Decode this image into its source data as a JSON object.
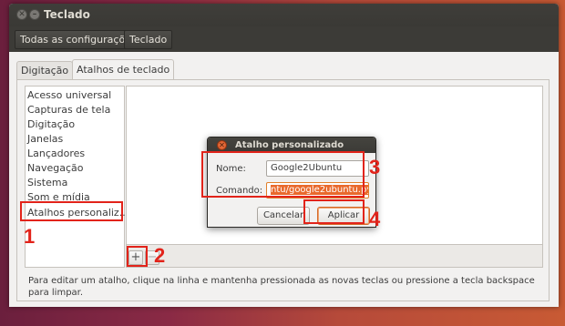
{
  "window": {
    "title": "Teclado",
    "breadcrumbs": [
      "Todas as configurações",
      "Teclado"
    ]
  },
  "tabs": [
    "Digitação",
    "Atalhos de teclado"
  ],
  "categories": [
    "Acesso universal",
    "Capturas de tela",
    "Digitação",
    "Janelas",
    "Lançadores",
    "Navegação",
    "Sistema",
    "Som e mídia",
    "Atalhos personaliz..."
  ],
  "list_buttons": {
    "add": "+",
    "remove": "−"
  },
  "help_text": "Para editar um atalho, clique na linha e mantenha pressionada as novas teclas ou pressione a tecla backspace para limpar.",
  "dialog": {
    "title": "Atalho personalizado",
    "name_label": "Nome:",
    "name_value": "Google2Ubuntu",
    "command_label": "Comando:",
    "command_value": "ntu/google2ubuntu.py",
    "cancel_label": "Cancelar",
    "apply_label": "Aplicar"
  },
  "annotations": [
    "1",
    "2",
    "3",
    "4"
  ],
  "colors": {
    "annotation": "#e2231a",
    "selection": "#e9692c"
  }
}
